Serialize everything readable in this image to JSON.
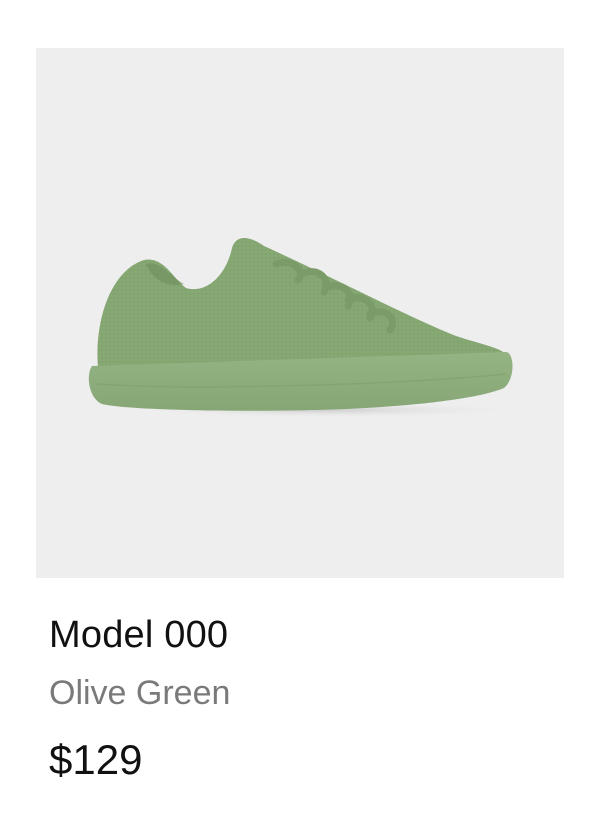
{
  "product": {
    "name": "Model 000",
    "color": "Olive Green",
    "price": "$129",
    "image_icon": "sneaker-product-image"
  },
  "colors": {
    "image_background": "#eeeeef",
    "shoe_upper": "#86a873",
    "shoe_sole": "#8fb07d",
    "title_text": "#111111",
    "subtitle_text": "#7a7a7a"
  }
}
